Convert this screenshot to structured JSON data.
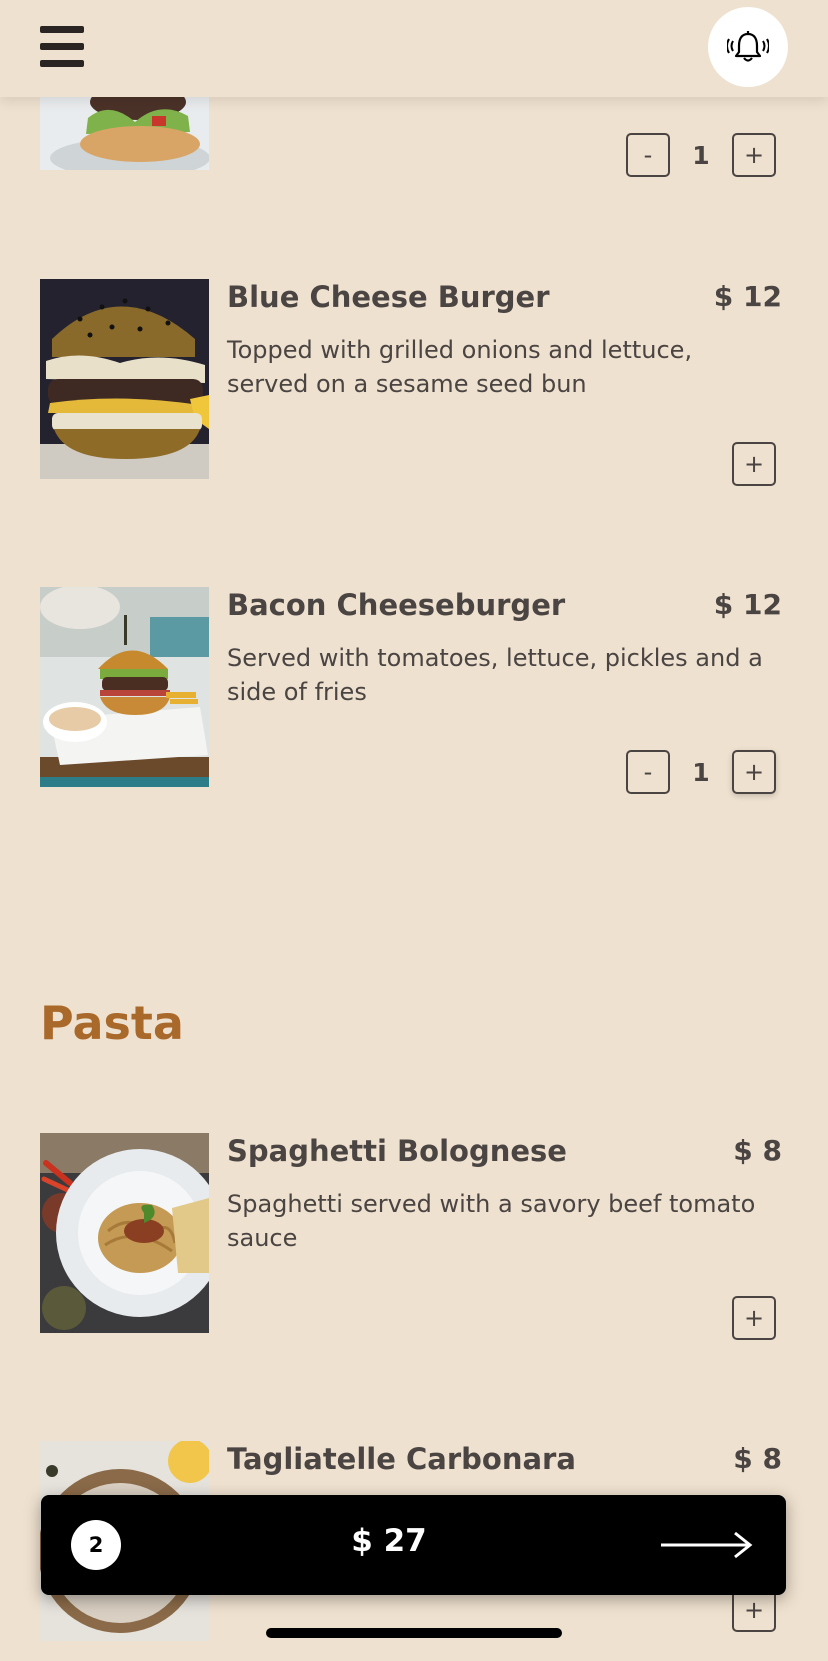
{
  "header": {
    "menu_icon": "hamburger-menu-icon",
    "bell_icon": "ringing-bell-icon"
  },
  "top_partial_item": {
    "quantity": "1",
    "minus_label": "-",
    "plus_label": "+"
  },
  "items": [
    {
      "name": "Blue Cheese Burger",
      "price": "$ 12",
      "description": "Topped with grilled onions and lettuce, served on a sesame seed bun",
      "plus_label": "+"
    },
    {
      "name": "Bacon Cheeseburger",
      "price": "$ 12",
      "description": "Served with tomatoes, lettuce, pickles and a side of fries",
      "quantity": "1",
      "minus_label": "-",
      "plus_label": "+"
    }
  ],
  "pasta": {
    "section_title": "Pasta",
    "items": [
      {
        "name": "Spaghetti Bolognese",
        "price": "$ 8",
        "description": "Spaghetti served with a savory beef tomato sauce",
        "plus_label": "+"
      },
      {
        "name": "Tagliatelle Carbonara",
        "price": "$ 8",
        "plus_label": "+"
      }
    ]
  },
  "cart": {
    "count": "2",
    "total": "$ 27",
    "arrow_icon": "right-arrow-icon"
  },
  "colors": {
    "background": "#efe1cf",
    "text": "#4a4442",
    "section_title": "#a9692b",
    "cart_bar": "#000000"
  }
}
